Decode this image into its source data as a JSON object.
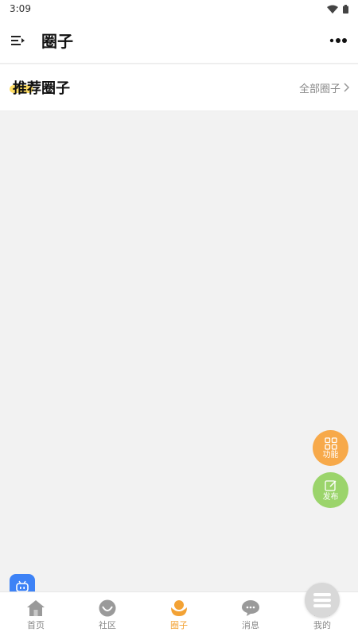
{
  "status_bar": {
    "time": "3:09",
    "icons": [
      "wifi-icon",
      "battery-icon"
    ]
  },
  "header": {
    "title": "圈子",
    "menu_icon": "menu-icon",
    "more_icon": "more-icon"
  },
  "section": {
    "title": "推荐圈子",
    "all_label": "全部圈子",
    "highlight_color": "#ffd84a"
  },
  "fabs": {
    "function_label": "功能",
    "function_color": "#f7a94a",
    "post_label": "发布",
    "post_color": "#9bd46b"
  },
  "tabbar": {
    "items": [
      {
        "label": "首页",
        "icon": "home-icon"
      },
      {
        "label": "社区",
        "icon": "community-icon"
      },
      {
        "label": "圈子",
        "icon": "circle-icon",
        "active": true
      },
      {
        "label": "消息",
        "icon": "message-icon"
      },
      {
        "label": "我的",
        "icon": "profile-icon"
      }
    ],
    "active_color": "#f3a234"
  }
}
